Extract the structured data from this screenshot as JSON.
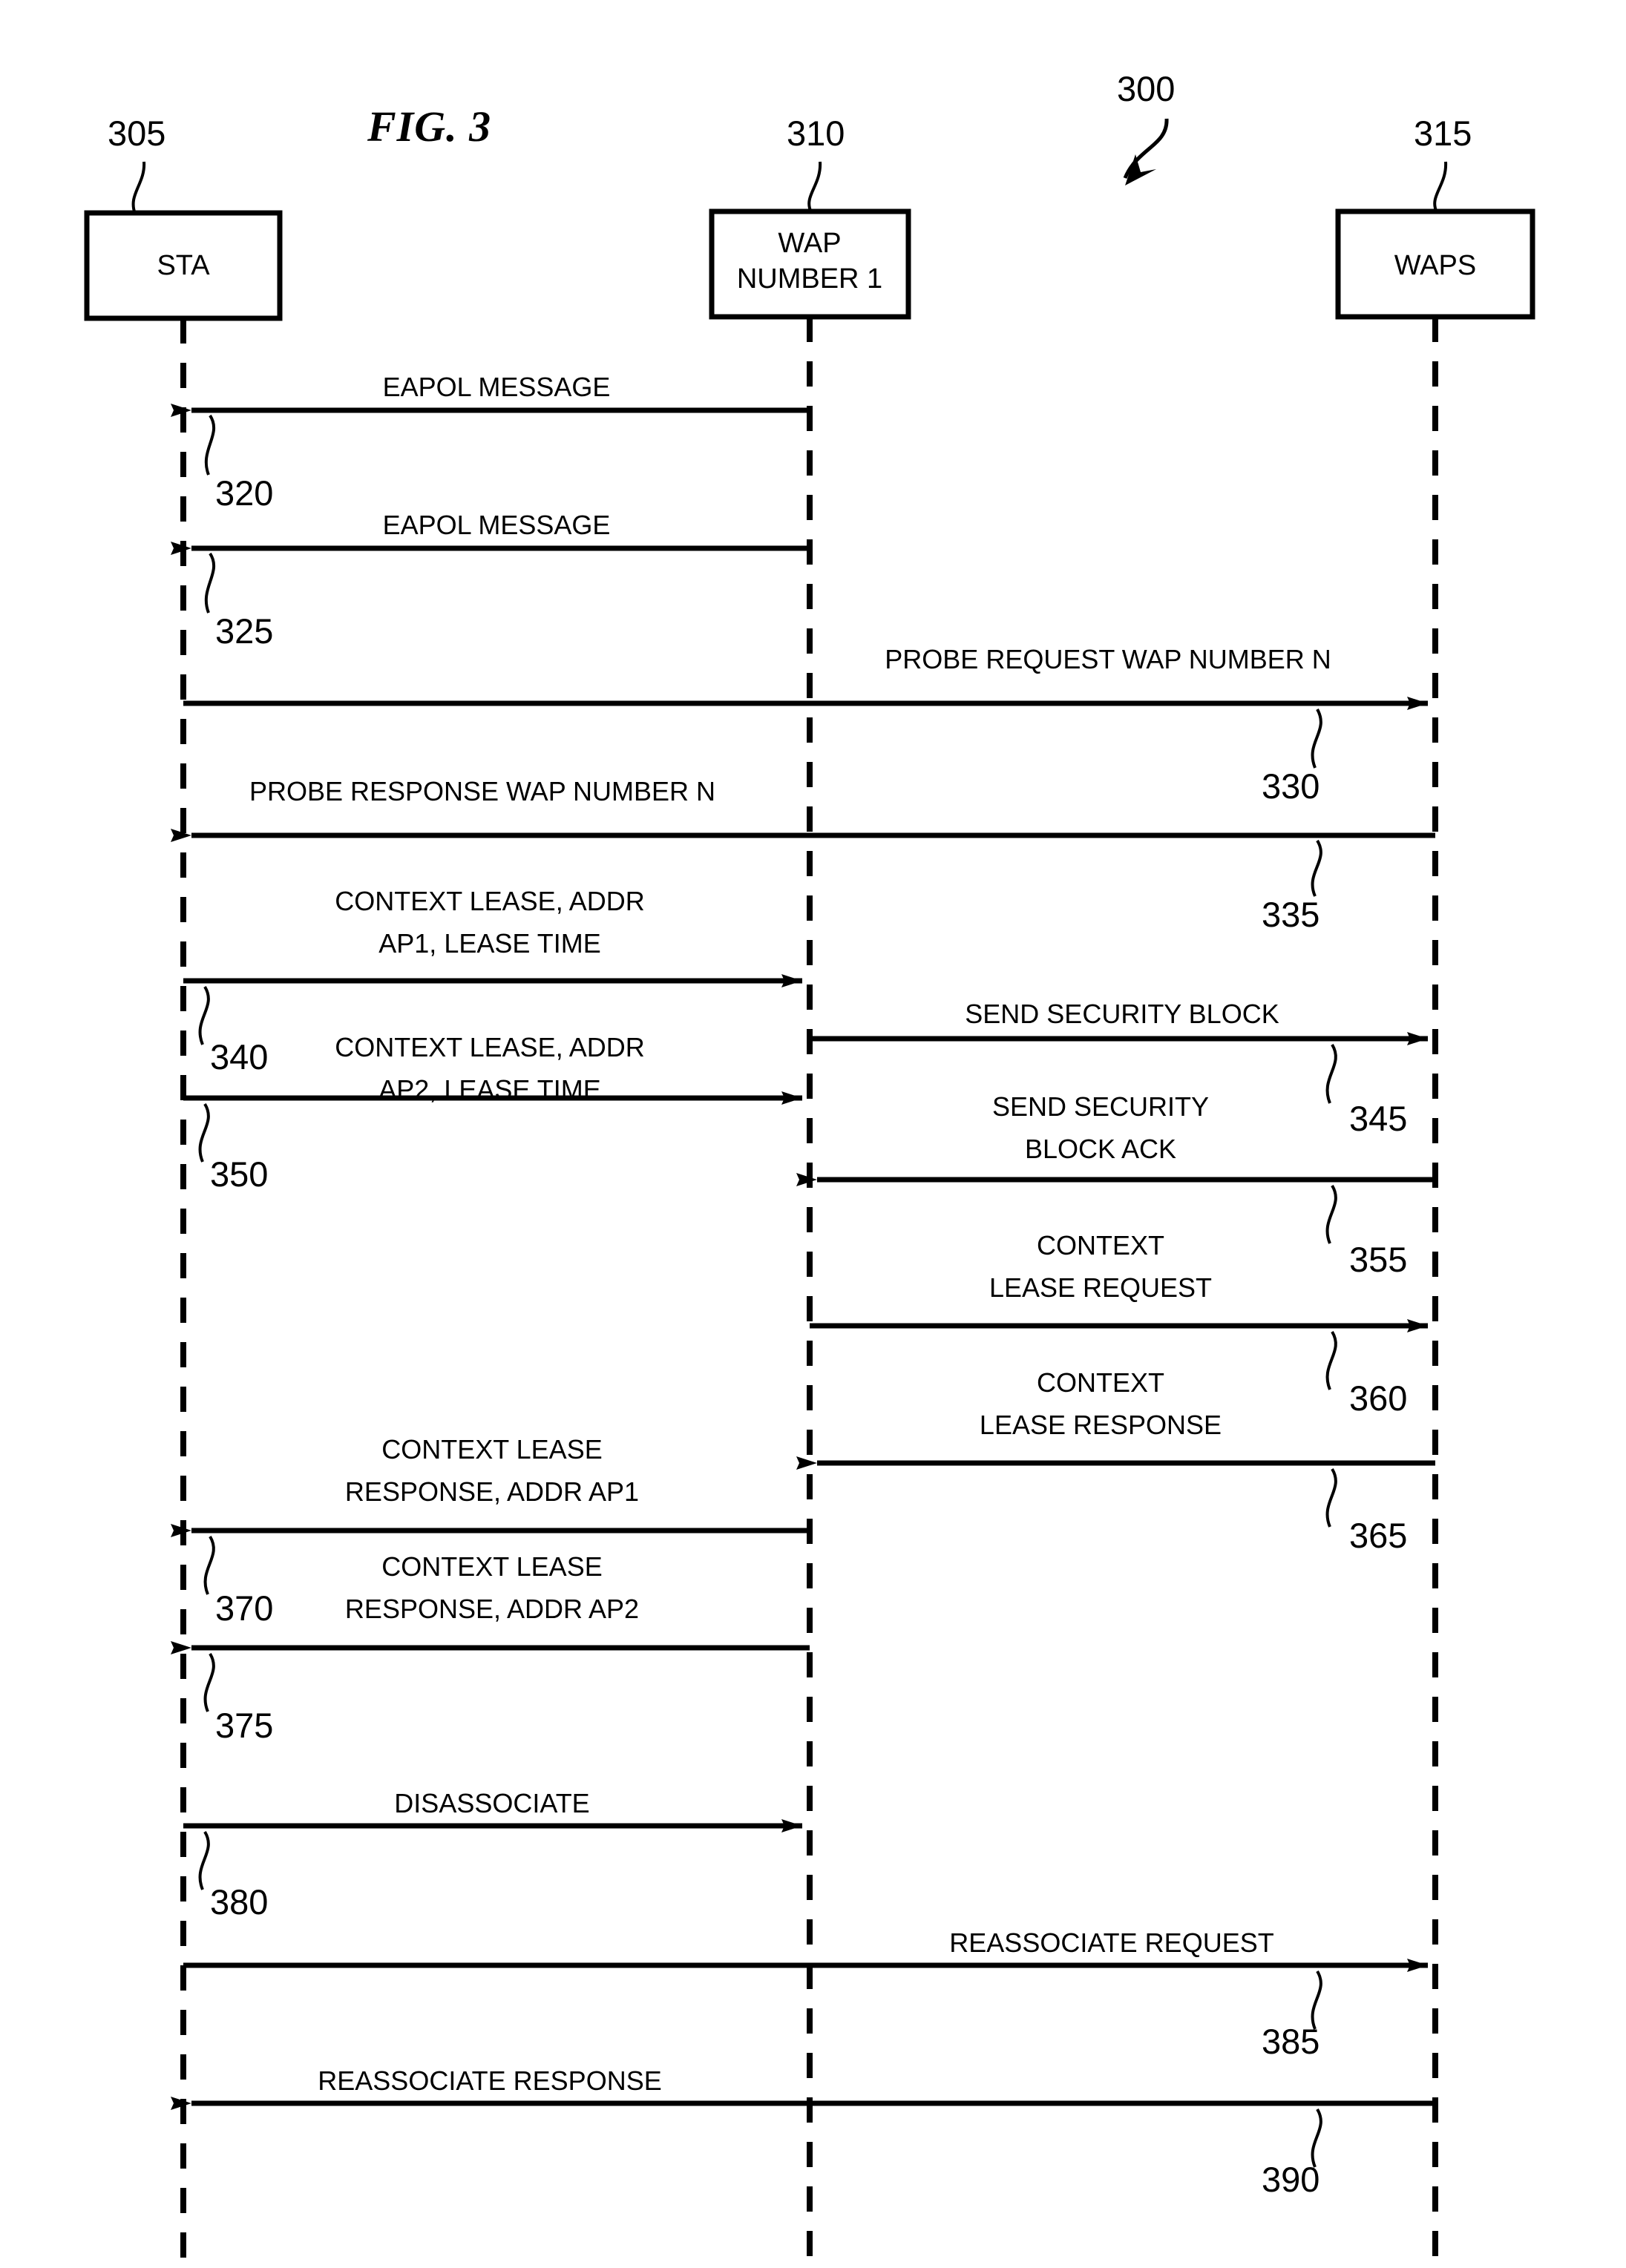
{
  "figure": {
    "title": "FIG. 3",
    "diagram_ref": "300"
  },
  "lifelines": [
    {
      "ref": "305",
      "label": "STA",
      "label_line2": ""
    },
    {
      "ref": "310",
      "label": "WAP",
      "label_line2": "NUMBER 1"
    },
    {
      "ref": "315",
      "label": "WAPS",
      "label_line2": ""
    }
  ],
  "messages": [
    {
      "ref": "320",
      "line1": "EAPOL MESSAGE",
      "line2": ""
    },
    {
      "ref": "325",
      "line1": "EAPOL MESSAGE",
      "line2": ""
    },
    {
      "ref": "330",
      "line1": "PROBE REQUEST WAP NUMBER N",
      "line2": ""
    },
    {
      "ref": "335",
      "line1": "PROBE RESPONSE WAP NUMBER N",
      "line2": ""
    },
    {
      "ref": "340",
      "line1": "CONTEXT LEASE, ADDR",
      "line2": "AP1, LEASE TIME"
    },
    {
      "ref": "345",
      "line1": "SEND SECURITY BLOCK",
      "line2": ""
    },
    {
      "ref": "350",
      "line1": "CONTEXT LEASE, ADDR",
      "line2": "AP2, LEASE TIME"
    },
    {
      "ref": "355",
      "line1": "SEND SECURITY",
      "line2": "BLOCK ACK"
    },
    {
      "ref": "360",
      "line1": "CONTEXT",
      "line2": "LEASE REQUEST"
    },
    {
      "ref": "365",
      "line1": "CONTEXT",
      "line2": "LEASE RESPONSE"
    },
    {
      "ref": "370",
      "line1": "CONTEXT LEASE",
      "line2": "RESPONSE, ADDR AP1"
    },
    {
      "ref": "375",
      "line1": "CONTEXT LEASE",
      "line2": "RESPONSE, ADDR AP2"
    },
    {
      "ref": "380",
      "line1": "DISASSOCIATE",
      "line2": ""
    },
    {
      "ref": "385",
      "line1": "REASSOCIATE REQUEST",
      "line2": ""
    },
    {
      "ref": "390",
      "line1": "REASSOCIATE RESPONSE",
      "line2": ""
    }
  ],
  "colors": {
    "ink": "#000000",
    "paper": "#ffffff"
  }
}
